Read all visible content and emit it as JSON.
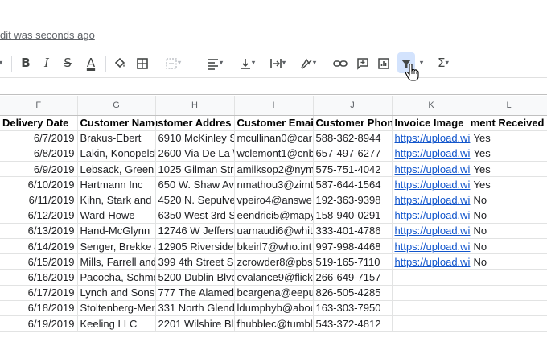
{
  "last_edit": "dit was seconds ago",
  "toolbar": {
    "bold": "B",
    "italic": "I",
    "strike": "S",
    "text_color": "A",
    "sum": "Σ"
  },
  "columns": [
    "F",
    "G",
    "H",
    "I",
    "J",
    "K",
    "L"
  ],
  "headers": [
    "Delivery Date",
    "Customer Name",
    "ustomer Addres",
    "Customer Email",
    "Customer Phone",
    "Invoice Image",
    "yment Received"
  ],
  "rows": [
    [
      "6/7/2019",
      "Brakus-Ebert",
      "6910 McKinley S",
      "mcullinan0@car",
      "588-362-8944",
      "https://upload.wi",
      "Yes"
    ],
    [
      "6/8/2019",
      "Lakin, Konopelsl",
      "2600 Via De La \\",
      "wclemont1@cnb",
      "657-497-6277",
      "https://upload.wi",
      "Yes"
    ],
    [
      "6/9/2019",
      "Lebsack, Green",
      "1025 Gilman Str",
      "amilksop2@nym",
      "575-751-4042",
      "https://upload.wi",
      "Yes"
    ],
    [
      "6/10/2019",
      "Hartmann Inc",
      "650 W. Shaw Av",
      "nmathou3@zimt",
      "587-644-1564",
      "https://upload.wi",
      "Yes"
    ],
    [
      "6/11/2019",
      "Kihn, Stark and",
      "4520 N. Sepulve",
      "vpeiro4@answe",
      "192-363-9398",
      "https://upload.wi",
      "No"
    ],
    [
      "6/12/2019",
      "Ward-Howe",
      "6350 West 3rd S",
      "eendrici5@mapy",
      "158-940-0291",
      "https://upload.wi",
      "No"
    ],
    [
      "6/13/2019",
      "Hand-McGlynn",
      "12746 W Jeffers",
      "uarnaudi6@whit",
      "333-401-4786",
      "https://upload.wi",
      "No"
    ],
    [
      "6/14/2019",
      "Senger, Brekke a",
      "12905 Riverside",
      "bkeirl7@who.int",
      "997-998-4468",
      "https://upload.wi",
      "No"
    ],
    [
      "6/15/2019",
      "Mills, Farrell and",
      "399 4th Street S",
      "zcrowder8@pbs",
      "519-165-7110",
      "https://upload.wi",
      "No"
    ],
    [
      "6/16/2019",
      "Pacocha, Schme",
      "5200 Dublin Blvc",
      "cvalance9@flick",
      "266-649-7157",
      "",
      ""
    ],
    [
      "6/17/2019",
      "Lynch and Sons",
      "777 The Alamed",
      "bcargena@eepu",
      "826-505-4285",
      "",
      ""
    ],
    [
      "6/18/2019",
      "Stoltenberg-Mer",
      "331 North Glend",
      "ldumphyb@abou",
      "163-303-7950",
      "",
      ""
    ],
    [
      "6/19/2019",
      "Keeling LLC",
      "2201 Wilshire Bl",
      "fhubblec@tumbl",
      "543-372-4812",
      "",
      ""
    ]
  ],
  "colors": {
    "link": "#1155cc",
    "header_bg": "#f8f9fa",
    "filter_active_bg": "#d3e3fd",
    "text_color_bar": "#000000"
  }
}
